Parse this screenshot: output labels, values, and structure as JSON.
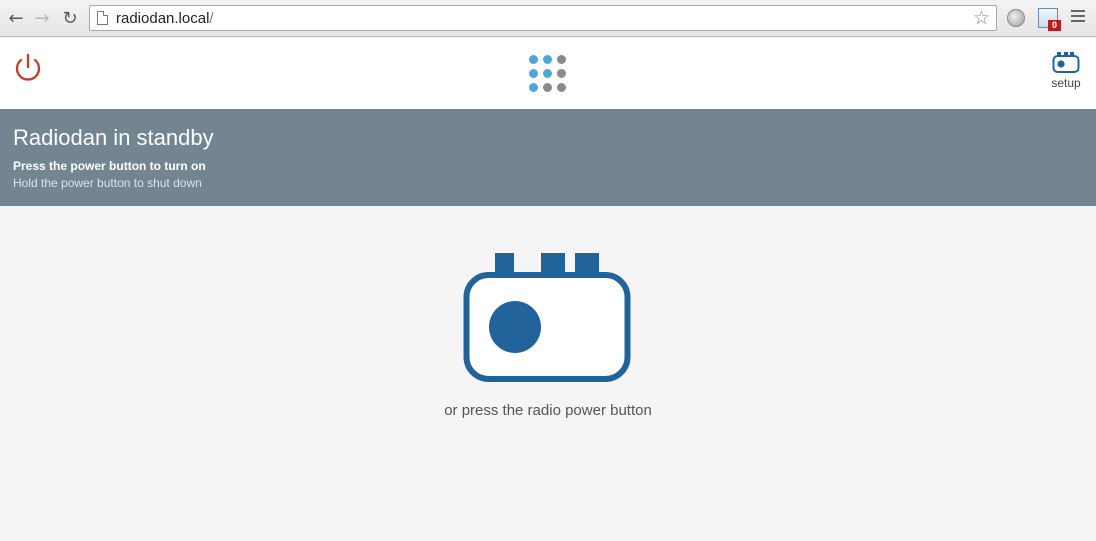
{
  "browser": {
    "url_host": "radiodan.local",
    "url_path": "/",
    "back_icon": "back-arrow-icon",
    "forward_icon": "forward-arrow-icon",
    "reload_icon": "reload-icon",
    "bookmark_icon": "star-icon",
    "extension_badge": "0",
    "menu_icon": "hamburger-menu-icon"
  },
  "header": {
    "power_icon": "power-icon",
    "logo_icon": "radiodan-dots-logo",
    "setup_label": "setup",
    "colors": {
      "power": "#c0432e",
      "dot_blue": "#4ba8d6",
      "dot_grey": "#8a8a8a",
      "radio_blue": "#23639b"
    }
  },
  "banner": {
    "title": "Radiodan in standby",
    "line1": "Press the power button to turn on",
    "line2": "Hold the power button to shut down",
    "background": "#738591"
  },
  "main": {
    "radio_icon": "radio-icon",
    "caption": "or press the radio power button"
  }
}
